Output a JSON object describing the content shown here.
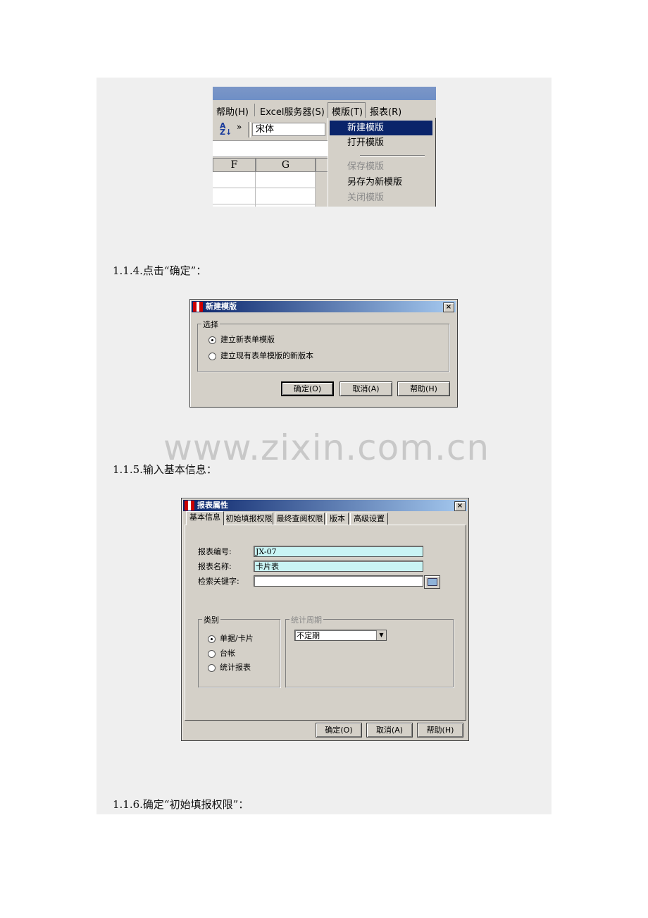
{
  "menu_screenshot": {
    "menubar": [
      "帮助(H)",
      "Excel服务器(S)",
      "模版(T)",
      "报表(R)"
    ],
    "font_box": "宋体",
    "sort_icon": "sort-az-icon",
    "columns": [
      "F",
      "G"
    ],
    "dropdown_items": [
      {
        "label": "新建模版",
        "state": "selected"
      },
      {
        "label": "打开模版",
        "state": "normal"
      },
      {
        "label": "保存模版",
        "state": "disabled"
      },
      {
        "label": "另存为新模版",
        "state": "normal"
      },
      {
        "label": "关闭模版",
        "state": "disabled"
      }
    ]
  },
  "step_114": "1.1.4.点击“确定”：",
  "dialog_new_template": {
    "title": "新建模版",
    "close": "×",
    "group_label": "选择",
    "options": [
      {
        "label": "建立新表单模版",
        "checked": true
      },
      {
        "label": "建立现有表单模版的新版本",
        "checked": false
      }
    ],
    "buttons": {
      "ok": "确定(O)",
      "cancel": "取消(A)",
      "help": "帮助(H)"
    }
  },
  "watermark": "www.zixin.com.cn",
  "step_115": "1.1.5.输入基本信息：",
  "dialog_report_props": {
    "title": "报表属性",
    "close": "×",
    "tabs": [
      "基本信息",
      "初始填报权限",
      "最终查阅权限",
      "版本",
      "高级设置"
    ],
    "fields": {
      "code_label": "报表编号:",
      "code_value": "JX-07",
      "name_label": "报表名称:",
      "name_value": "卡片表",
      "keyword_label": "检索关键字:",
      "keyword_value": ""
    },
    "category": {
      "label": "类别",
      "options": [
        {
          "label": "单据/卡片",
          "checked": true
        },
        {
          "label": "台帐",
          "checked": false
        },
        {
          "label": "统计报表",
          "checked": false
        }
      ]
    },
    "period": {
      "label": "统计周期",
      "value": "不定期"
    },
    "buttons": {
      "ok": "确定(O)",
      "cancel": "取消(A)",
      "help": "帮助(H)"
    }
  },
  "step_116": "1.1.6.确定“初始填报权限”："
}
